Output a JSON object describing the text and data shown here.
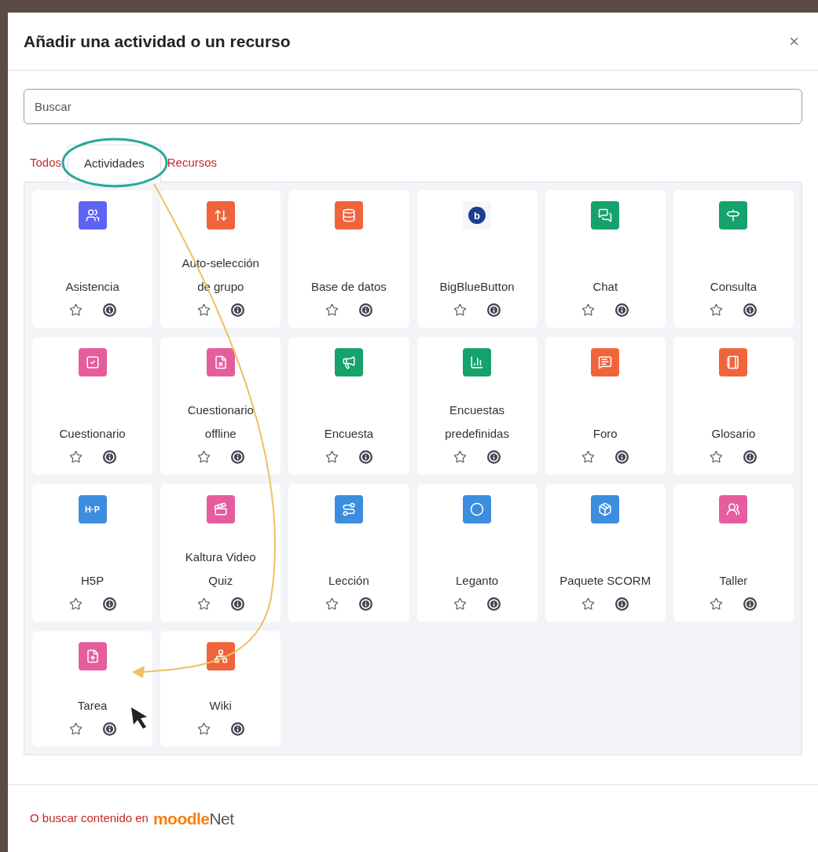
{
  "dialog": {
    "title": "Añadir una actividad o un recurso",
    "close": "×"
  },
  "search": {
    "placeholder": "Buscar"
  },
  "tabs": [
    {
      "label": "Todos",
      "selected": false
    },
    {
      "label": "Actividades",
      "selected": true
    },
    {
      "label": "Recursos",
      "selected": false
    }
  ],
  "items": [
    {
      "label": "Asistencia",
      "color": "#5d63f6"
    },
    {
      "label": "Auto-selección\nde grupo",
      "color": "#f0643c"
    },
    {
      "label": "Base de datos",
      "color": "#f0643c"
    },
    {
      "label": "BigBlueButton",
      "color": "#f5f6f8",
      "icon_label": "b"
    },
    {
      "label": "Chat",
      "color": "#16a26b"
    },
    {
      "label": "Consulta",
      "color": "#16a26b"
    },
    {
      "label": "Cuestionario",
      "color": "#e65d9e"
    },
    {
      "label": "Cuestionario\noffline",
      "color": "#e65d9e"
    },
    {
      "label": "Encuesta",
      "color": "#16a26b"
    },
    {
      "label": "Encuestas\npredefinidas",
      "color": "#16a26b"
    },
    {
      "label": "Foro",
      "color": "#f0643c"
    },
    {
      "label": "Glosario",
      "color": "#f0643c"
    },
    {
      "label": "H5P",
      "color": "#3b8ede",
      "icon_label": "H·P"
    },
    {
      "label": "Kaltura Video\nQuiz",
      "color": "#e65d9e"
    },
    {
      "label": "Lección",
      "color": "#3b8ede"
    },
    {
      "label": "Leganto",
      "color": "#3b8ede"
    },
    {
      "label": "Paquete SCORM",
      "color": "#3b8ede"
    },
    {
      "label": "Taller",
      "color": "#e65d9e"
    },
    {
      "label": "Tarea",
      "color": "#e65d9e"
    },
    {
      "label": "Wiki",
      "color": "#f0643c"
    }
  ],
  "footer": {
    "link": "O buscar contenido en",
    "logo_main": "moodle",
    "logo_suffix": "Net"
  }
}
